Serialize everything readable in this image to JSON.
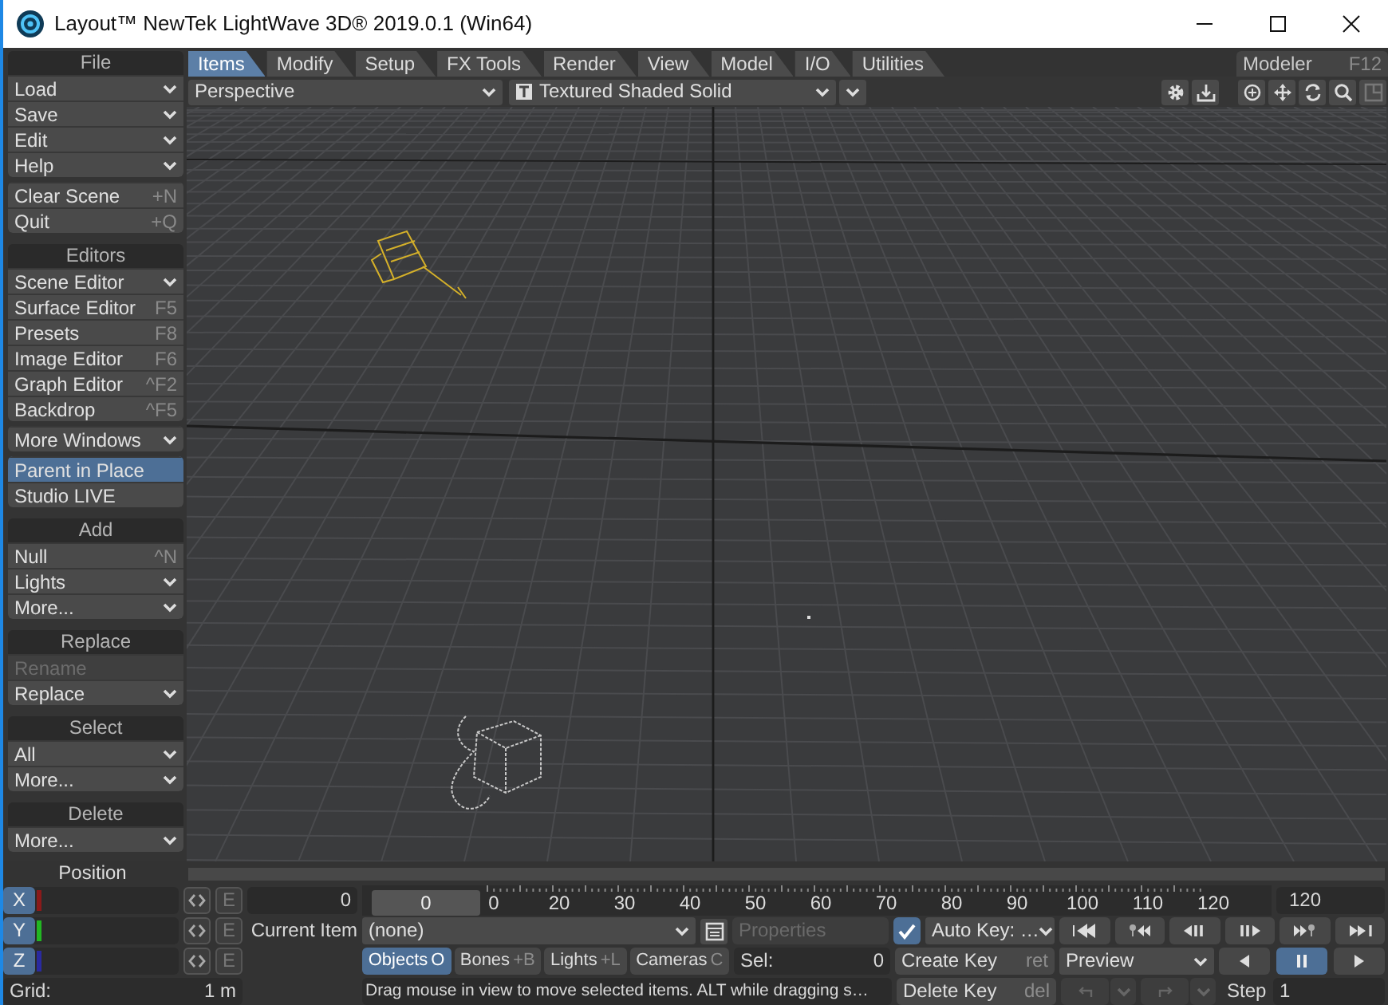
{
  "window": {
    "title": "Layout™ NewTek LightWave 3D® 2019.0.1 (Win64)"
  },
  "sidebar": {
    "sections": [
      {
        "header": "File",
        "items": [
          {
            "label": "Load",
            "kind": "menu"
          },
          {
            "label": "Save",
            "kind": "menu"
          },
          {
            "label": "Edit",
            "kind": "menu"
          },
          {
            "label": "Help",
            "kind": "menu"
          }
        ]
      },
      {
        "items": [
          {
            "label": "Clear Scene",
            "kind": "command",
            "shortcut": "+N"
          },
          {
            "label": "Quit",
            "kind": "command",
            "shortcut": "+Q"
          }
        ]
      },
      {
        "header": "Editors",
        "items": [
          {
            "label": "Scene Editor",
            "kind": "menu"
          },
          {
            "label": "Surface Editor",
            "kind": "command",
            "shortcut": "F5"
          },
          {
            "label": "Presets",
            "kind": "command",
            "shortcut": "F8"
          },
          {
            "label": "Image Editor",
            "kind": "command",
            "shortcut": "F6"
          },
          {
            "label": "Graph Editor",
            "kind": "command",
            "shortcut": "^F2"
          },
          {
            "label": "Backdrop",
            "kind": "command",
            "shortcut": "^F5"
          }
        ]
      },
      {
        "items": [
          {
            "label": "More Windows",
            "kind": "menu"
          }
        ]
      },
      {
        "items": [
          {
            "label": "Parent in Place",
            "kind": "command",
            "on": true
          },
          {
            "label": "Studio LIVE",
            "kind": "command",
            "on": false
          }
        ]
      },
      {
        "header": "Add",
        "items": [
          {
            "label": "Null",
            "kind": "command",
            "shortcut": "^N"
          },
          {
            "label": "Lights",
            "kind": "menu"
          },
          {
            "label": "More...",
            "kind": "menu"
          }
        ]
      },
      {
        "header": "Replace",
        "items": [
          {
            "label": "Rename",
            "kind": "command",
            "disabled": true
          },
          {
            "label": "Replace",
            "kind": "menu",
            "disabled": false
          }
        ]
      },
      {
        "header": "Select",
        "items": [
          {
            "label": "All",
            "kind": "menu"
          },
          {
            "label": "More...",
            "kind": "menu"
          }
        ]
      },
      {
        "header": "Delete",
        "items": [
          {
            "label": "More...",
            "kind": "menu"
          }
        ]
      }
    ]
  },
  "tabs": [
    {
      "label": "Items",
      "selected": true
    },
    {
      "label": "Modify",
      "selected": false
    },
    {
      "label": "Setup",
      "selected": false
    },
    {
      "label": "FX Tools",
      "selected": false
    },
    {
      "label": "Render",
      "selected": false
    },
    {
      "label": "View",
      "selected": false
    },
    {
      "label": "Model",
      "selected": false
    },
    {
      "label": "I/O",
      "selected": false
    },
    {
      "label": "Utilities",
      "selected": false
    }
  ],
  "modeler": {
    "label": "Modeler",
    "shortcut": "F12"
  },
  "viewport_toolbar": {
    "view": "Perspective",
    "render_mode": "Textured Shaded Solid"
  },
  "position": {
    "title": "Position",
    "axes": [
      {
        "label": "X",
        "color": "#8b1a1a",
        "envelope": "E"
      },
      {
        "label": "Y",
        "color": "#22b722",
        "envelope": "E"
      },
      {
        "label": "Z",
        "color": "#2a2aa0",
        "envelope": "E"
      }
    ],
    "grid_label": "Grid:",
    "grid_value": "1 m"
  },
  "timeline": {
    "level": 0,
    "current_frame": "0",
    "slider_value": "0",
    "ticks": [
      "0",
      "20",
      "30",
      "40",
      "50",
      "60",
      "70",
      "80",
      "90",
      "100",
      "110",
      "120"
    ],
    "end_frame": "120"
  },
  "current_item": {
    "label": "Current Item",
    "value": "(none)",
    "properties": {
      "label": "Properties",
      "disabled": true
    }
  },
  "item_types": [
    {
      "label": "Objects",
      "shortcut": "O",
      "selected": true
    },
    {
      "label": "Bones",
      "shortcut": "+B",
      "selected": false
    },
    {
      "label": "Lights",
      "shortcut": "+L",
      "selected": false
    },
    {
      "label": "Cameras",
      "shortcut": "C",
      "selected": false
    }
  ],
  "selection": {
    "label": "Sel:",
    "value": "0"
  },
  "auto_key": {
    "checked": true,
    "label": "Auto Key: …"
  },
  "create_key": {
    "label": "Create Key",
    "shortcut": "ret"
  },
  "delete_key": {
    "label": "Delete Key",
    "shortcut": "del"
  },
  "preview": {
    "label": "Preview"
  },
  "playback": [
    {
      "kind": "reverse",
      "selected": false
    },
    {
      "kind": "pause",
      "selected": true
    },
    {
      "kind": "play",
      "selected": false
    }
  ],
  "history": {
    "disabled": true
  },
  "step": {
    "label": "Step",
    "value": "1"
  },
  "status_bar": {
    "text": "Drag mouse in view to move selected items. ALT while dragging s…"
  }
}
